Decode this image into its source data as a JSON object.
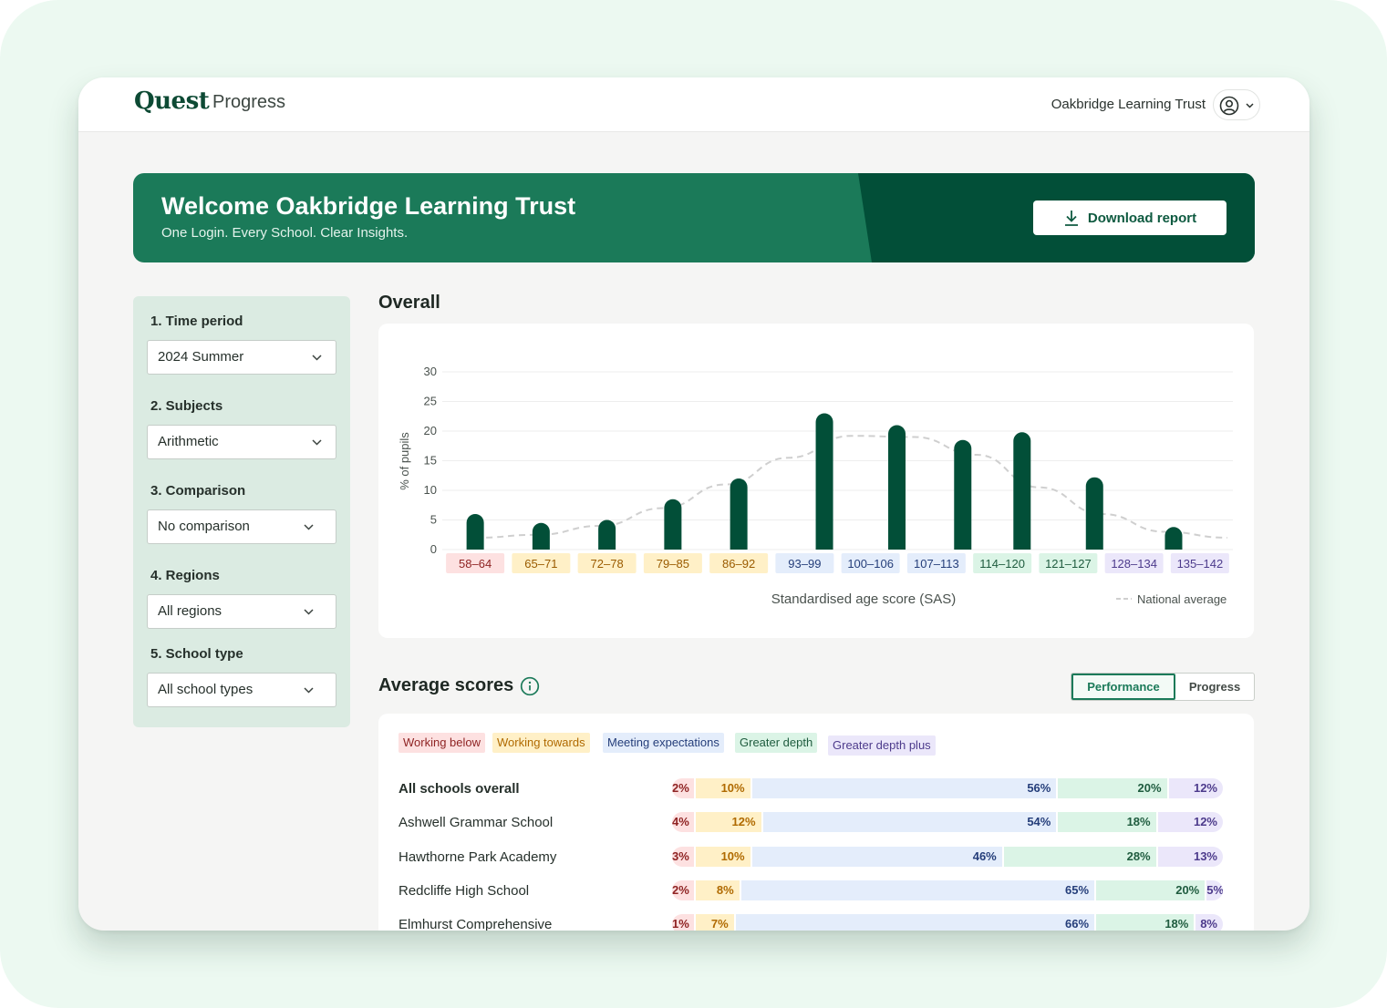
{
  "app": {
    "logo": "Quest",
    "product": "Progress"
  },
  "header": {
    "org_name": "Oakbridge Learning Trust",
    "account_icon": "user-circle-icon"
  },
  "banner": {
    "title": "Welcome Oakbridge Learning Trust",
    "subtitle": "One Login. Every School. Clear Insights.",
    "download_label": "Download report",
    "colors": {
      "light": "#1b7a59",
      "dark": "#024f38"
    }
  },
  "filters": [
    {
      "label": "1. Time period",
      "value": "2024 Summer"
    },
    {
      "label": "2. Subjects",
      "value": "Arithmetic"
    },
    {
      "label": "3. Comparison",
      "value": "No comparison"
    },
    {
      "label": "4. Regions",
      "value": "All regions"
    },
    {
      "label": "5. School type",
      "value": "All school types"
    }
  ],
  "overall": {
    "title": "Overall",
    "legend_label": "National average"
  },
  "chart_data": {
    "type": "bar",
    "title": "Overall",
    "categories": [
      "58–64",
      "65–71",
      "72–78",
      "79–85",
      "86–92",
      "93–99",
      "100–106",
      "107–113",
      "114–120",
      "121–127",
      "128–134",
      "135–142"
    ],
    "series": [
      {
        "name": "",
        "values": [
          6,
          4.5,
          5,
          8.5,
          12,
          23,
          21,
          18.5,
          19.8,
          12.2,
          3.8
        ],
        "color": "#024f38"
      }
    ],
    "values": [
      6,
      4.5,
      5,
      8.5,
      12,
      23,
      21,
      18.5,
      19.8,
      12.2,
      3.8
    ],
    "bar_positions": [
      0,
      1,
      2,
      3,
      4,
      5.3,
      6.4,
      7.4,
      8.3,
      9.4,
      10.6
    ],
    "national_average": [
      2,
      2.5,
      4,
      7,
      11,
      15.5,
      19.2,
      19,
      16,
      10.5,
      6,
      3,
      2
    ],
    "xlabel": "Standardised age score (SAS)",
    "ylabel": "% of pupils",
    "ylim": [
      0,
      30
    ],
    "yticks": [
      "0",
      "5",
      "10",
      "15",
      "20",
      "25",
      "30"
    ],
    "grid": true,
    "legend_position": "bottom-right",
    "category_colors": [
      {
        "bg": "#fde1e1",
        "fg": "#8f2424"
      },
      {
        "bg": "#fff0c7",
        "fg": "#9a5b00"
      },
      {
        "bg": "#fff0c7",
        "fg": "#9a5b00"
      },
      {
        "bg": "#fff0c7",
        "fg": "#9a5b00"
      },
      {
        "bg": "#fff0c7",
        "fg": "#9a5b00"
      },
      {
        "bg": "#e4edfb",
        "fg": "#253e7a"
      },
      {
        "bg": "#e4edfb",
        "fg": "#253e7a"
      },
      {
        "bg": "#e4edfb",
        "fg": "#253e7a"
      },
      {
        "bg": "#dbf4e6",
        "fg": "#1f5c3f"
      },
      {
        "bg": "#dbf4e6",
        "fg": "#1f5c3f"
      },
      {
        "bg": "#ebe7fa",
        "fg": "#4d3b8c"
      },
      {
        "bg": "#ebe7fa",
        "fg": "#4d3b8c"
      }
    ]
  },
  "average_scores": {
    "title": "Average scores",
    "info_icon": "info-icon",
    "toggle": {
      "active": "Performance",
      "inactive": "Progress"
    },
    "legend": [
      {
        "label": "Working below",
        "bg": "#fde1e1",
        "fg": "#8f2424"
      },
      {
        "label": "Working towards",
        "bg": "#fff0c7",
        "fg": "#b06a00"
      },
      {
        "label": "Meeting expectations",
        "bg": "#e4edfb",
        "fg": "#253e7a"
      },
      {
        "label": "Greater depth",
        "bg": "#dbf4e6",
        "fg": "#1f5c3f"
      },
      {
        "label": "Greater depth plus",
        "bg": "#ebe7fa",
        "fg": "#4d3b8c"
      }
    ],
    "rows": [
      {
        "name": "All schools overall",
        "values": [
          2,
          10,
          56,
          20,
          12
        ],
        "labels": [
          "2%",
          "10%",
          "56%",
          "20%",
          "12%"
        ]
      },
      {
        "name": "Ashwell Grammar School",
        "values": [
          4,
          12,
          54,
          18,
          12
        ],
        "labels": [
          "4%",
          "12%",
          "54%",
          "18%",
          "12%"
        ]
      },
      {
        "name": "Hawthorne Park Academy",
        "values": [
          3,
          10,
          46,
          28,
          13
        ],
        "labels": [
          "3%",
          "10%",
          "46%",
          "28%",
          "13%"
        ]
      },
      {
        "name": "Redcliffe High School",
        "values": [
          2,
          8,
          65,
          20,
          5
        ],
        "labels": [
          "2%",
          "8%",
          "65%",
          "20%",
          "5%"
        ]
      },
      {
        "name": "Elmhurst Comprehensive",
        "values": [
          1,
          7,
          66,
          18,
          8
        ],
        "labels": [
          "1%",
          "7%",
          "66%",
          "18%",
          "8%"
        ]
      }
    ]
  }
}
